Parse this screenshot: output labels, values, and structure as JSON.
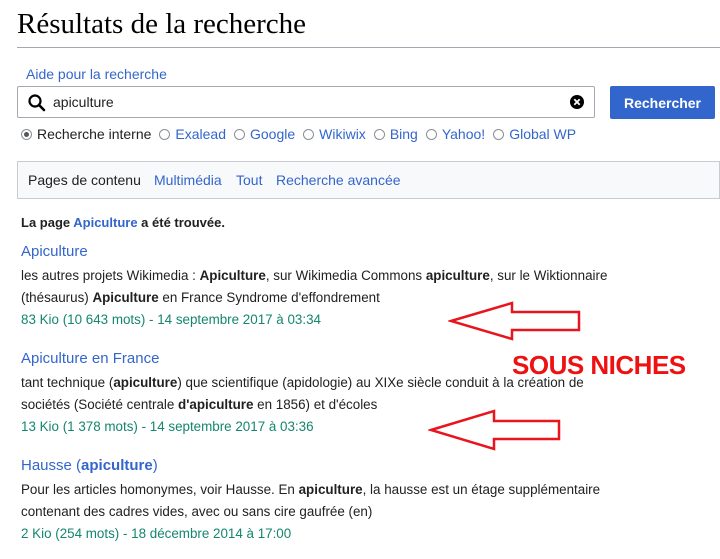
{
  "page_title": "Résultats de la recherche",
  "help_link": "Aide pour la recherche",
  "search": {
    "value": "apiculture",
    "button": "Rechercher"
  },
  "engines": [
    {
      "label": "Recherche interne",
      "selected": true
    },
    {
      "label": "Exalead",
      "selected": false
    },
    {
      "label": "Google",
      "selected": false
    },
    {
      "label": "Wikiwix",
      "selected": false
    },
    {
      "label": "Bing",
      "selected": false
    },
    {
      "label": "Yahoo!",
      "selected": false
    },
    {
      "label": "Global WP",
      "selected": false
    }
  ],
  "profiles": [
    "Pages de contenu",
    "Multimédia",
    "Tout",
    "Recherche avancée"
  ],
  "found": {
    "prefix": "La page ",
    "link": "Apiculture",
    "suffix": " a été trouvée."
  },
  "results": [
    {
      "title_link": "Apiculture",
      "title_rest": "",
      "snippet_line1": [
        "les autres projets Wikimedia : ",
        "Apiculture",
        ", sur Wikimedia Commons ",
        "apiculture",
        ", sur le Wiktionnaire"
      ],
      "snippet_line2": [
        "(thésaurus) ",
        "Apiculture",
        " en France Syndrome d'effondrement"
      ],
      "meta": "83 Kio (10 643 mots) - 14 septembre 2017 à 03:34"
    },
    {
      "title_link": "Apiculture",
      "title_rest": " en France",
      "snippet_line1": [
        "tant technique (",
        "apiculture",
        ") que scientifique (apidologie) au XIXe siècle conduit à la création de"
      ],
      "snippet_line2": [
        "sociétés (Société centrale ",
        "d'apiculture",
        " en 1856) et d'écoles"
      ],
      "meta": "13 Kio (1 378 mots) - 14 septembre 2017 à 03:36"
    },
    {
      "title_link": "Hausse (",
      "title_bold": "apiculture",
      "title_rest": ")",
      "snippet_line1": [
        "Pour les articles homonymes, voir Hausse. En ",
        "apiculture",
        ", la hausse est un étage supplémentaire"
      ],
      "snippet_line2": [
        "contenant des cadres vides, avec ou sans cire gaufrée (en)"
      ],
      "meta": "2 Kio (254 mots) - 18 décembre 2014 à 17:00"
    }
  ],
  "annotation": {
    "text": "SOUS NICHES",
    "color": "#ee1111"
  },
  "colors": {
    "link": "#3366cc",
    "meta": "#14866d",
    "button": "#3366cc"
  }
}
